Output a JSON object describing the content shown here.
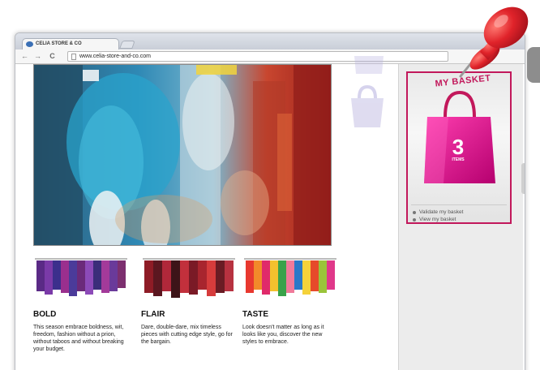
{
  "browser": {
    "tab_title": "CELIA STORE & CO",
    "url": "www.celia-store-and-co.com",
    "nav": {
      "back": "←",
      "forward": "→",
      "reload": "C"
    }
  },
  "columns": [
    {
      "title": "BOLD",
      "text": "This season embrace boldness, wit, freedom, fashion without a prion, without taboos and without breaking your budget."
    },
    {
      "title": "FLAIR",
      "text": "Dare, double-dare, mix timeless pieces with cutting edge style, go for the bargain."
    },
    {
      "title": "TASTE",
      "text": "Look doesn't matter as long as it looks like you, discover the new styles to embrace."
    }
  ],
  "basket": {
    "title": "MY BASKET",
    "count": "3",
    "count_label": "ITEMS",
    "links": [
      "Validate my basket",
      "View my basket"
    ]
  },
  "colors": {
    "accent": "#c2185b",
    "bag": "#e0108e",
    "pin": "#d81f26"
  },
  "icons": [
    "back-arrow-icon",
    "forward-arrow-icon",
    "reload-icon",
    "page-icon",
    "shopping-bag-icon",
    "push-pin-icon"
  ]
}
